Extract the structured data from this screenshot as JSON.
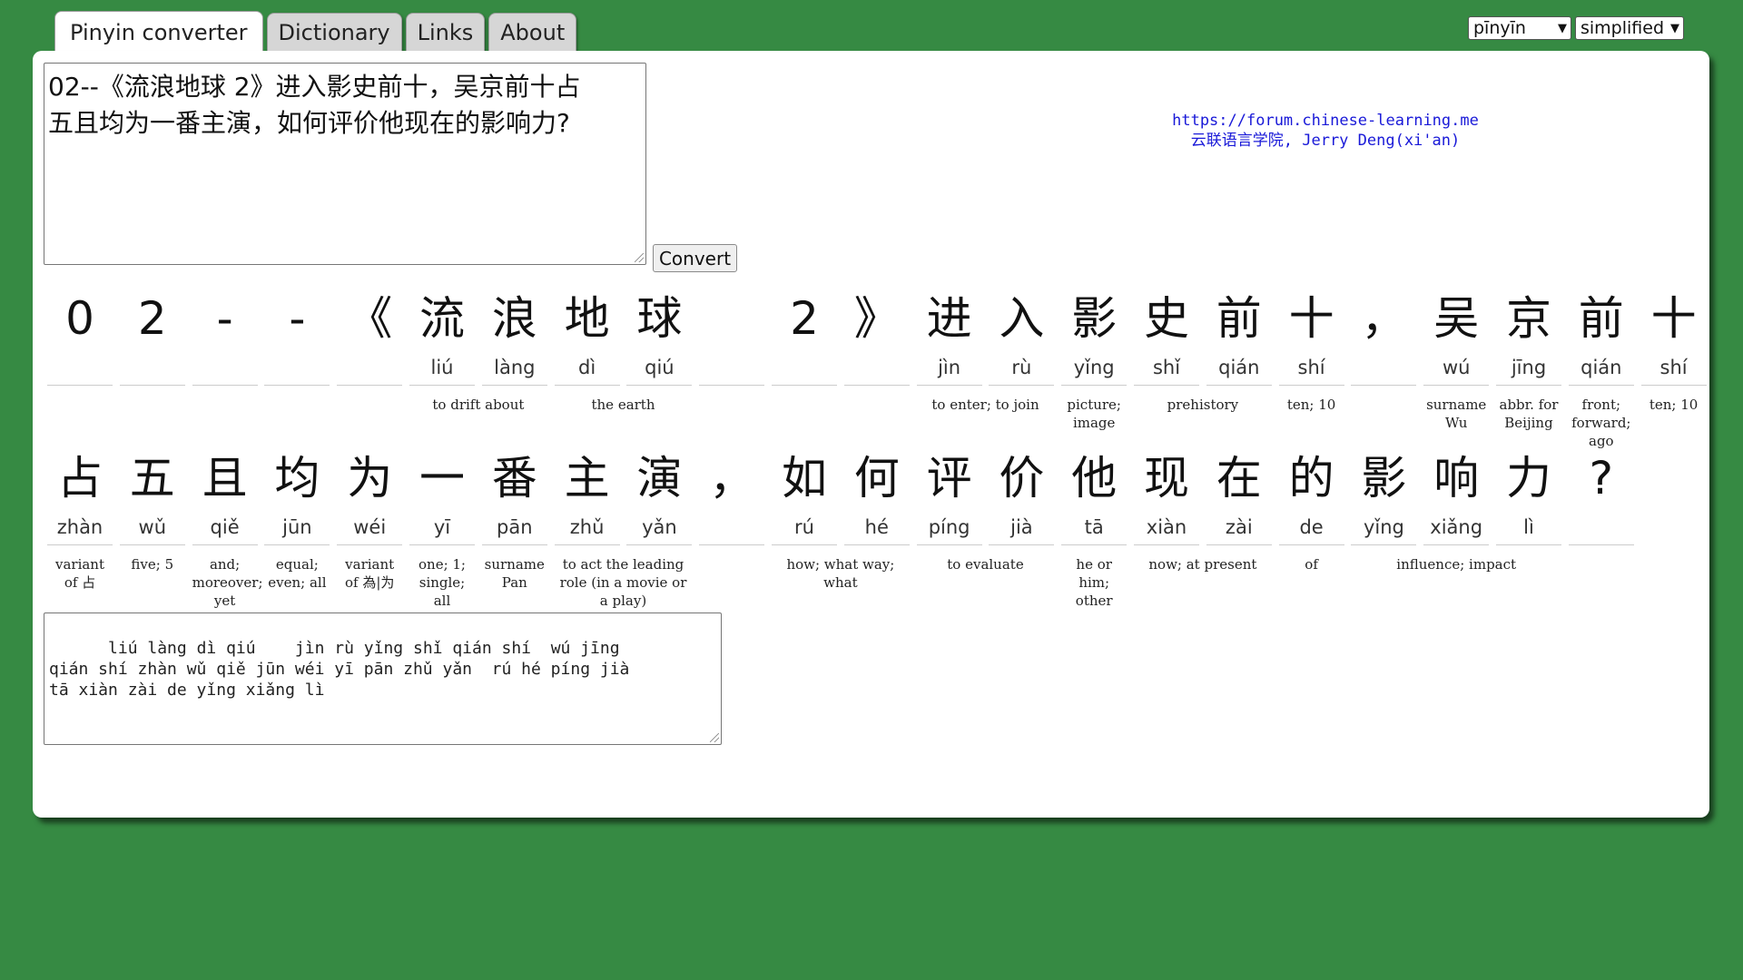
{
  "tabs": [
    "Pinyin converter",
    "Dictionary",
    "Links",
    "About"
  ],
  "selectors": {
    "tone": "pīnyīn",
    "script": "simplified"
  },
  "input": {
    "line1": "02--《流浪地球 2》进入影史前十，吴京前十占",
    "line2": "五且均为一番主演，如何评价他现在的影响力?"
  },
  "convert_label": "Convert",
  "credits": {
    "url": "https://forum.chinese-learning.me",
    "author": "云联语言学院, Jerry Deng(xi'an)"
  },
  "row1": {
    "chars": [
      {
        "h": "0",
        "p": ""
      },
      {
        "h": "2",
        "p": ""
      },
      {
        "h": "-",
        "p": ""
      },
      {
        "h": "-",
        "p": ""
      },
      {
        "h": "《",
        "p": ""
      },
      {
        "h": "流",
        "p": "liú"
      },
      {
        "h": "浪",
        "p": "làng"
      },
      {
        "h": "地",
        "p": "dì"
      },
      {
        "h": "球",
        "p": "qiú"
      },
      {
        "h": "",
        "p": ""
      },
      {
        "h": "2",
        "p": ""
      },
      {
        "h": "》",
        "p": ""
      },
      {
        "h": "进",
        "p": "jìn"
      },
      {
        "h": "入",
        "p": "rù"
      },
      {
        "h": "影",
        "p": "yǐng"
      },
      {
        "h": "史",
        "p": "shǐ"
      },
      {
        "h": "前",
        "p": "qián"
      },
      {
        "h": "十",
        "p": "shí"
      },
      {
        "h": "，",
        "p": ""
      },
      {
        "h": "吴",
        "p": "wú"
      },
      {
        "h": "京",
        "p": "jīng"
      },
      {
        "h": "前",
        "p": "qián"
      },
      {
        "h": "十",
        "p": "shí"
      }
    ],
    "glosses": [
      {
        "start": 5,
        "span": 2,
        "text": "to drift about"
      },
      {
        "start": 7,
        "span": 2,
        "text": "the earth"
      },
      {
        "start": 12,
        "span": 2,
        "text": "to enter; to join"
      },
      {
        "start": 14,
        "span": 1,
        "text": "picture; image"
      },
      {
        "start": 15,
        "span": 2,
        "text": "prehistory"
      },
      {
        "start": 17,
        "span": 1,
        "text": "ten; 10"
      },
      {
        "start": 19,
        "span": 1,
        "text": "surname Wu"
      },
      {
        "start": 20,
        "span": 1,
        "text": "abbr. for Beijing"
      },
      {
        "start": 21,
        "span": 1,
        "text": "front; forward; ago"
      },
      {
        "start": 22,
        "span": 1,
        "text": "ten; 10"
      }
    ]
  },
  "row2": {
    "chars": [
      {
        "h": "占",
        "p": "zhàn"
      },
      {
        "h": "五",
        "p": "wǔ"
      },
      {
        "h": "且",
        "p": "qiě"
      },
      {
        "h": "均",
        "p": "jūn"
      },
      {
        "h": "为",
        "p": "wéi"
      },
      {
        "h": "一",
        "p": "yī"
      },
      {
        "h": "番",
        "p": "pān"
      },
      {
        "h": "主",
        "p": "zhǔ"
      },
      {
        "h": "演",
        "p": "yǎn"
      },
      {
        "h": "，",
        "p": ""
      },
      {
        "h": "如",
        "p": "rú"
      },
      {
        "h": "何",
        "p": "hé"
      },
      {
        "h": "评",
        "p": "píng"
      },
      {
        "h": "价",
        "p": "jià"
      },
      {
        "h": "他",
        "p": "tā"
      },
      {
        "h": "现",
        "p": "xiàn"
      },
      {
        "h": "在",
        "p": "zài"
      },
      {
        "h": "的",
        "p": "de"
      },
      {
        "h": "影",
        "p": "yǐng"
      },
      {
        "h": "响",
        "p": "xiǎng"
      },
      {
        "h": "力",
        "p": "lì"
      },
      {
        "h": "?",
        "p": ""
      }
    ],
    "glosses": [
      {
        "start": 0,
        "span": 1,
        "text": "variant of 占"
      },
      {
        "start": 1,
        "span": 1,
        "text": "five; 5"
      },
      {
        "start": 2,
        "span": 1,
        "text": "and; moreover; yet"
      },
      {
        "start": 3,
        "span": 1,
        "text": "equal; even; all"
      },
      {
        "start": 4,
        "span": 1,
        "text": "variant of 為|为"
      },
      {
        "start": 5,
        "span": 1,
        "text": "one; 1; single; all"
      },
      {
        "start": 6,
        "span": 1,
        "text": "surname Pan"
      },
      {
        "start": 7,
        "span": 2,
        "text": "to act the leading role (in a movie or a play)"
      },
      {
        "start": 10,
        "span": 2,
        "text": "how; what way; what"
      },
      {
        "start": 12,
        "span": 2,
        "text": "to evaluate"
      },
      {
        "start": 14,
        "span": 1,
        "text": "he or him; other"
      },
      {
        "start": 15,
        "span": 2,
        "text": "now; at present"
      },
      {
        "start": 17,
        "span": 1,
        "text": "of"
      },
      {
        "start": 18,
        "span": 3,
        "text": "influence; impact"
      }
    ]
  },
  "output_text": "    liú làng dì qiú    jìn rù yǐng shǐ qián shí  wú jīng\nqián shí zhàn wǔ qiě jūn wéi yī pān zhǔ yǎn  rú hé píng jià\ntā xiàn zài de yǐng xiǎng lì"
}
